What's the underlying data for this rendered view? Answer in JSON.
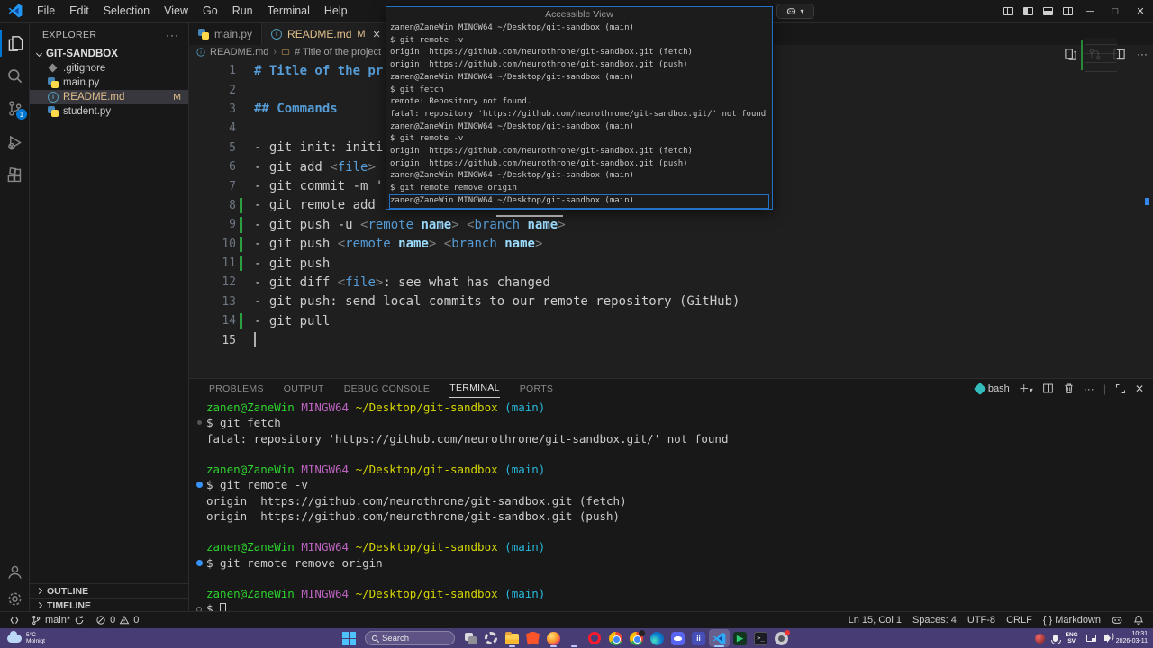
{
  "colors": {
    "accent": "#0078d4",
    "modified": "#e2c08d",
    "git_added": "#2ea043",
    "term_green": "#2dd42d",
    "term_magenta": "#bd63c1",
    "term_yellow": "#d6d600",
    "term_cyan": "#29b8db",
    "taskbar": "#483c74",
    "overlay_border": "#2472c8"
  },
  "title_bar": {
    "menus": [
      "File",
      "Edit",
      "Selection",
      "View",
      "Go",
      "Run",
      "Terminal",
      "Help"
    ],
    "window_controls": [
      "minimize",
      "maximize",
      "close"
    ]
  },
  "accessible_view": {
    "title": "Accessible View",
    "focused_line_index": 14,
    "lines": [
      "zanen@ZaneWin MINGW64 ~/Desktop/git-sandbox (main)",
      "$ git remote -v",
      "origin  https://github.com/neurothrone/git-sandbox.git (fetch)",
      "origin  https://github.com/neurothrone/git-sandbox.git (push)",
      "zanen@ZaneWin MINGW64 ~/Desktop/git-sandbox (main)",
      "$ git fetch",
      "remote: Repository not found.",
      "fatal: repository 'https://github.com/neurothrone/git-sandbox.git/' not found",
      "zanen@ZaneWin MINGW64 ~/Desktop/git-sandbox (main)",
      "$ git remote -v",
      "origin  https://github.com/neurothrone/git-sandbox.git (fetch)",
      "origin  https://github.com/neurothrone/git-sandbox.git (push)",
      "zanen@ZaneWin MINGW64 ~/Desktop/git-sandbox (main)",
      "$ git remote remove origin",
      "zanen@ZaneWin MINGW64 ~/Desktop/git-sandbox (main)"
    ]
  },
  "activity_bar": {
    "scm_badge": "1"
  },
  "explorer": {
    "header": "EXPLORER",
    "root": "GIT-SANDBOX",
    "files": [
      {
        "name": ".gitignore",
        "icon": "gitignore"
      },
      {
        "name": "main.py",
        "icon": "python"
      },
      {
        "name": "README.md",
        "icon": "info",
        "badge": "M",
        "selected": true,
        "modified": true
      },
      {
        "name": "student.py",
        "icon": "python"
      }
    ],
    "sections": [
      "OUTLINE",
      "TIMELINE"
    ]
  },
  "tabs": [
    {
      "name": "main.py",
      "icon": "python",
      "active": false
    },
    {
      "name": "README.md",
      "icon": "info",
      "badge": "M",
      "active": true
    }
  ],
  "breadcrumb": [
    "README.md",
    "# Title of the project"
  ],
  "editor": {
    "lines": [
      {
        "n": 1,
        "seg": [
          {
            "t": "# Title of the pr",
            "c": "h"
          }
        ]
      },
      {
        "n": 2,
        "seg": []
      },
      {
        "n": 3,
        "seg": [
          {
            "t": "## Commands",
            "c": "h"
          }
        ]
      },
      {
        "n": 4,
        "seg": []
      },
      {
        "n": 5,
        "seg": [
          {
            "t": "- git init: initi",
            "c": "t"
          }
        ]
      },
      {
        "n": 6,
        "seg": [
          {
            "t": "- git add ",
            "c": "t"
          },
          {
            "t": "<",
            "c": "p"
          },
          {
            "t": "file",
            "c": "g"
          },
          {
            "t": ">",
            "c": "p"
          }
        ]
      },
      {
        "n": 7,
        "seg": [
          {
            "t": "- git commit -m '",
            "c": "t"
          }
        ]
      },
      {
        "n": 8,
        "git": true,
        "seg": [
          {
            "t": "- git remote add ",
            "c": "t"
          }
        ]
      },
      {
        "n": 9,
        "git": true,
        "seg": [
          {
            "t": "- git push -u ",
            "c": "t"
          },
          {
            "t": "<",
            "c": "p"
          },
          {
            "t": "remote",
            "c": "g"
          },
          {
            "t": " name",
            "c": "a"
          },
          {
            "t": ">",
            "c": "p"
          },
          {
            "t": " ",
            "c": "t"
          },
          {
            "t": "<",
            "c": "p"
          },
          {
            "t": "branch",
            "c": "g"
          },
          {
            "t": " name",
            "c": "a"
          },
          {
            "t": ">",
            "c": "p"
          }
        ]
      },
      {
        "n": 10,
        "git": true,
        "seg": [
          {
            "t": "- git push ",
            "c": "t"
          },
          {
            "t": "<",
            "c": "p"
          },
          {
            "t": "remote",
            "c": "g"
          },
          {
            "t": " name",
            "c": "a"
          },
          {
            "t": ">",
            "c": "p"
          },
          {
            "t": " ",
            "c": "t"
          },
          {
            "t": "<",
            "c": "p"
          },
          {
            "t": "branch",
            "c": "g"
          },
          {
            "t": " name",
            "c": "a"
          },
          {
            "t": ">",
            "c": "p"
          }
        ]
      },
      {
        "n": 11,
        "git": true,
        "seg": [
          {
            "t": "- git push",
            "c": "t"
          }
        ]
      },
      {
        "n": 12,
        "seg": [
          {
            "t": "- git diff ",
            "c": "t"
          },
          {
            "t": "<",
            "c": "p"
          },
          {
            "t": "file",
            "c": "g"
          },
          {
            "t": ">",
            "c": "p"
          },
          {
            "t": ": see what has changed",
            "c": "t"
          }
        ]
      },
      {
        "n": 13,
        "seg": [
          {
            "t": "- git push: send local commits to our remote repository (GitHub)",
            "c": "t"
          }
        ]
      },
      {
        "n": 14,
        "git": true,
        "seg": [
          {
            "t": "- git pull",
            "c": "t"
          }
        ]
      },
      {
        "n": 15,
        "cursor": true,
        "seg": []
      }
    ]
  },
  "panel": {
    "tabs": [
      {
        "label": "PROBLEMS",
        "active": false
      },
      {
        "label": "OUTPUT",
        "active": false
      },
      {
        "label": "DEBUG CONSOLE",
        "active": false
      },
      {
        "label": "TERMINAL",
        "active": true
      },
      {
        "label": "PORTS",
        "active": false
      }
    ],
    "shell": "bash"
  },
  "terminal": {
    "prompt_segments": [
      {
        "t": "zanen@ZaneWin",
        "c": "u"
      },
      {
        "t": " MINGW64",
        "c": "m"
      },
      {
        "t": " ~/Desktop/git-sandbox",
        "c": "y"
      },
      {
        "t": " (main)",
        "c": "c"
      }
    ],
    "lines": [
      {
        "seg": "prompt"
      },
      {
        "dec": "dim",
        "seg": [
          {
            "t": "$ git fetch",
            "c": "w"
          }
        ]
      },
      {
        "seg": [
          {
            "t": "fatal: repository 'https://github.com/neurothrone/git-sandbox.git/' not found",
            "c": "w"
          }
        ]
      },
      {
        "seg": []
      },
      {
        "seg": "prompt"
      },
      {
        "dec": "blue",
        "seg": [
          {
            "t": "$ git remote -v",
            "c": "w"
          }
        ]
      },
      {
        "seg": [
          {
            "t": "origin  https://github.com/neurothrone/git-sandbox.git (fetch)",
            "c": "w"
          }
        ]
      },
      {
        "seg": [
          {
            "t": "origin  https://github.com/neurothrone/git-sandbox.git (push)",
            "c": "w"
          }
        ]
      },
      {
        "seg": []
      },
      {
        "seg": "prompt"
      },
      {
        "dec": "blue",
        "seg": [
          {
            "t": "$ git remote remove origin",
            "c": "w"
          }
        ]
      },
      {
        "seg": []
      },
      {
        "seg": "prompt"
      },
      {
        "dec": "circle",
        "cursor": true,
        "seg": [
          {
            "t": "$ ",
            "c": "w"
          }
        ]
      }
    ]
  },
  "status_bar": {
    "branch": "main*",
    "errors": "0",
    "warnings": "0",
    "right_items": [
      {
        "label": "Ln 15, Col 1",
        "name": "cursor-position"
      },
      {
        "label": "Spaces: 4",
        "name": "indentation"
      },
      {
        "label": "UTF-8",
        "name": "encoding"
      },
      {
        "label": "CRLF",
        "name": "eol"
      },
      {
        "label": "{ } Markdown",
        "name": "language-mode"
      }
    ]
  },
  "taskbar": {
    "weather": {
      "temp": "5°C",
      "desc": "Molnigt"
    },
    "search_placeholder": "Search",
    "apps": [
      {
        "id": "task-view"
      },
      {
        "id": "settings"
      },
      {
        "id": "file-explorer",
        "running": true
      },
      {
        "id": "brave"
      },
      {
        "id": "firefox",
        "running": true
      },
      {
        "id": "firefox-nightly",
        "running": true
      },
      {
        "id": "opera"
      },
      {
        "id": "chrome"
      },
      {
        "id": "chrome-profile"
      },
      {
        "id": "edge"
      },
      {
        "id": "discord"
      },
      {
        "id": "teams"
      },
      {
        "id": "vscode",
        "active": true
      },
      {
        "id": "green-ide"
      },
      {
        "id": "terminal"
      },
      {
        "id": "game-bar"
      }
    ],
    "tray": {
      "lang_top": "ENG",
      "lang_bottom": "SV",
      "time": "10:31",
      "date": "2026-03-11"
    }
  }
}
